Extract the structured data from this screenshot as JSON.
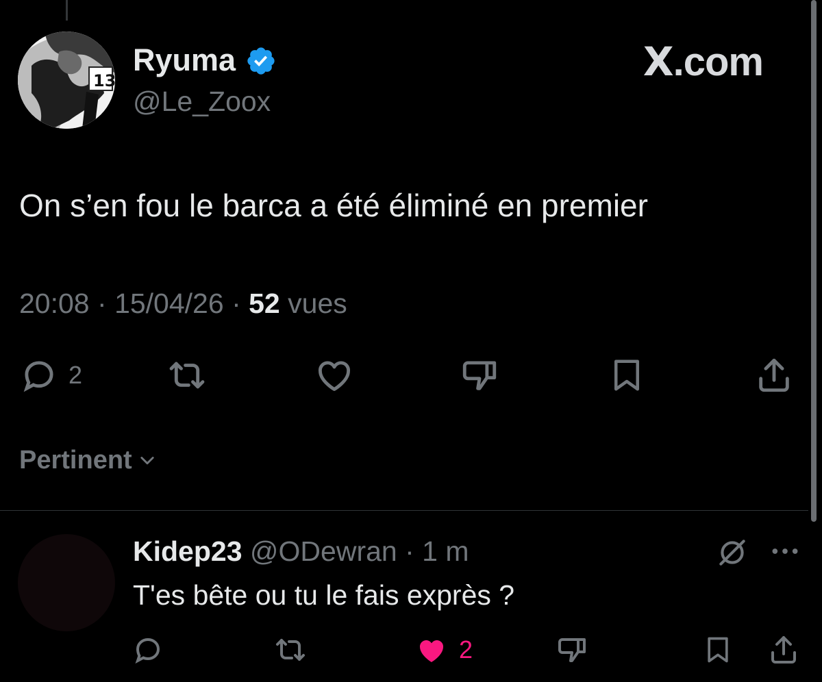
{
  "post": {
    "author_name": "Ryuma",
    "author_handle": "@Le_Zoox",
    "brand": "X.com",
    "text": "On s’en fou le barca a été éliminé en premier",
    "time": "20:08",
    "date": "15/04/26",
    "views_count": "52",
    "views_label": "vues",
    "actions": {
      "reply_count": "2"
    }
  },
  "sort_label": "Pertinent",
  "reply": {
    "author_name": "Kidep23",
    "author_handle": "@ODewran",
    "time": "1 m",
    "text": "T'es bête ou tu le fais exprès ?",
    "like_count": "2"
  },
  "colors": {
    "background": "#000000",
    "text": "#e7e9ea",
    "muted": "#71767b",
    "verified": "#1d9bf0",
    "like_active": "#f91880"
  },
  "icons": [
    "verified-badge-icon",
    "reply-icon",
    "repost-icon",
    "like-icon",
    "dislike-icon",
    "bookmark-icon",
    "share-icon",
    "chevron-down-icon",
    "mute-icon",
    "more-icon"
  ]
}
